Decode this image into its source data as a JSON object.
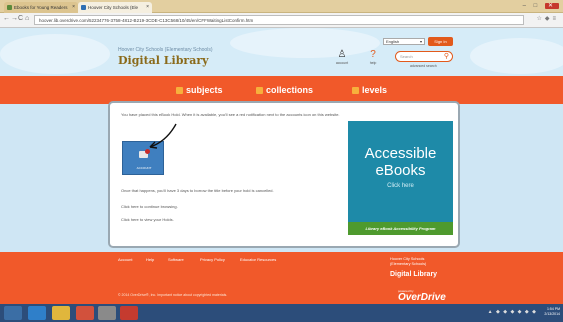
{
  "browser": {
    "tabs": [
      {
        "label": "Ebooks for Young Readers"
      },
      {
        "label": "Hoover City Schools (Ele"
      }
    ],
    "url": "hoover.lib.overdrive.com/52234776-3758-4812-B219-3CDE-C13C568/10/45/en/CFFWaitingListConfirm.htm",
    "back": "←",
    "forward": "→",
    "reload": "C",
    "home": "⌂",
    "win_min": "–",
    "win_max": "□",
    "win_close": "✕"
  },
  "header": {
    "school_name": "Hoover City Schools (Elementary Schools)",
    "title": "Digital Library",
    "account_label": "account",
    "help_label": "help",
    "language": "English",
    "signin_label": "Sign In",
    "search_placeholder": "Search",
    "advanced_search": "advanced search"
  },
  "nav": {
    "subjects": "subjects",
    "collections": "collections",
    "levels": "levels"
  },
  "content": {
    "message": "You have placed this eBook Hold. When it is available, you'll see a red notification next to the accounts icon on this website.",
    "kindle_label": "ACCOUNT",
    "followup": "Once that happens, you'll have 3 days to borrow the title before your hold is cancelled.",
    "continue_link": "Click here to continue browsing.",
    "view_holds_link": "Click here to view your Holds."
  },
  "promo": {
    "line1": "Accessible",
    "line2": "eBooks",
    "click": "Click here",
    "band": "Library eBook Accessibility Program"
  },
  "footer": {
    "links": [
      "Account",
      "Help",
      "Software",
      "Privacy Policy",
      "Educator Resources"
    ],
    "school": "Hoover City Schools",
    "school_sub": "(Elementary Schools)",
    "library": "Digital Library",
    "copyright": "© 2014 OverDrive®, Inc. Important notice about copyrighted materials.",
    "powered_by": "powered by",
    "overdrive": "OverDrive"
  },
  "taskbar": {
    "time": "1:54 PM",
    "date": "2/13/2014"
  },
  "colors": {
    "accent": "#f1592a",
    "promo": "#1e8aa8",
    "promo_band": "#4e9a2e"
  }
}
